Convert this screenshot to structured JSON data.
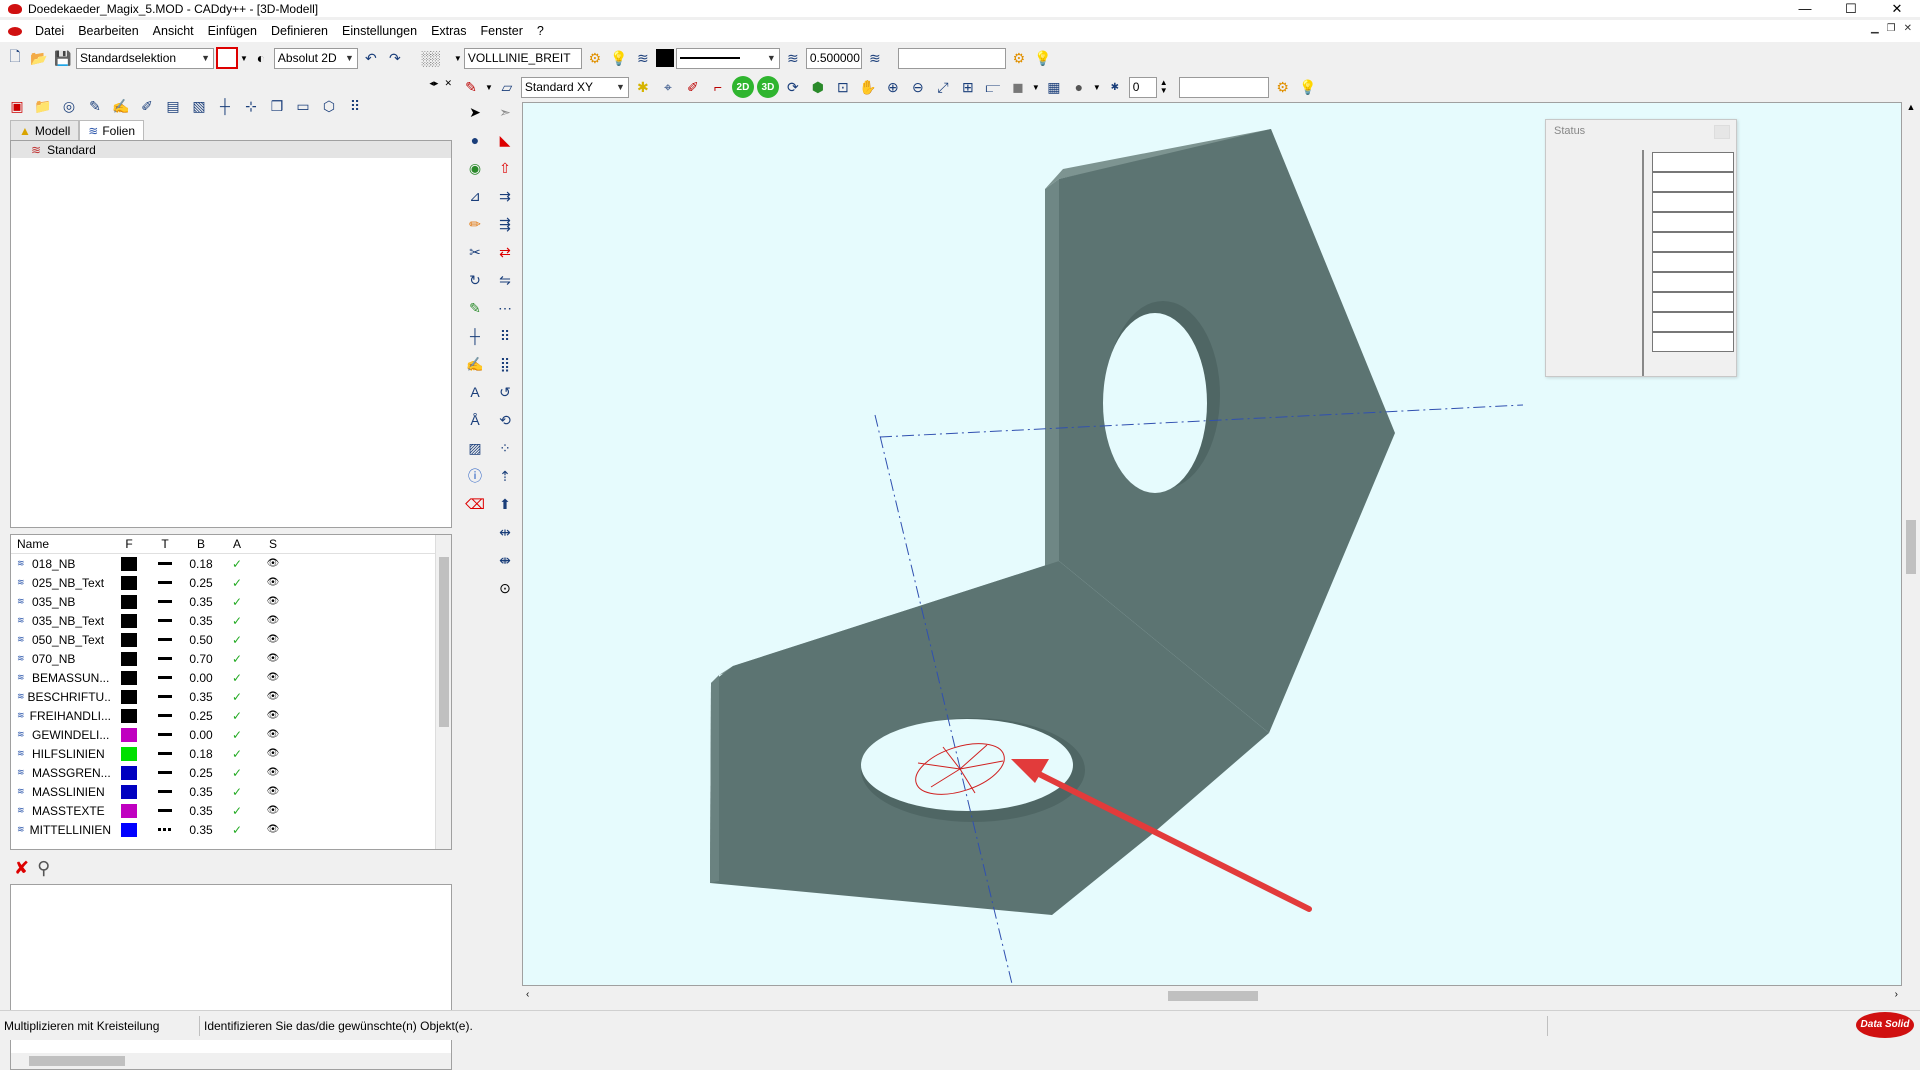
{
  "window": {
    "title": "Doedekaeder_Magix_5.MOD  -  CADdy++ - [3D-Modell]",
    "min": "—",
    "max": "☐",
    "close": "✕"
  },
  "menu": [
    "Datei",
    "Bearbeiten",
    "Ansicht",
    "Einfügen",
    "Definieren",
    "Einstellungen",
    "Extras",
    "Fenster",
    "?"
  ],
  "toolbar1": {
    "selection_mode": "Standardselektion",
    "coord_mode": "Absolut 2D",
    "linetype": "VOLLLINIE_BREIT",
    "linewidth": "0.500000",
    "empty_field": ""
  },
  "toolbar2": {
    "view_combo": "Standard XY",
    "btn_2d": "2D",
    "btn_3d": "3D",
    "counter": "0",
    "empty_field": ""
  },
  "left_panel": {
    "tabs": [
      "Modell",
      "Folien"
    ],
    "folien_tree": [
      "Standard"
    ],
    "columns": [
      "Name",
      "F",
      "T",
      "B",
      "A",
      "S"
    ],
    "layers": [
      {
        "name": "018_NB",
        "color": "#000000",
        "width": "0.18",
        "line": "solid"
      },
      {
        "name": "025_NB_Text",
        "color": "#000000",
        "width": "0.25",
        "line": "solid"
      },
      {
        "name": "035_NB",
        "color": "#000000",
        "width": "0.35",
        "line": "solid"
      },
      {
        "name": "035_NB_Text",
        "color": "#000000",
        "width": "0.35",
        "line": "solid"
      },
      {
        "name": "050_NB_Text",
        "color": "#000000",
        "width": "0.50",
        "line": "solid"
      },
      {
        "name": "070_NB",
        "color": "#000000",
        "width": "0.70",
        "line": "solid"
      },
      {
        "name": "BEMASSUN...",
        "color": "#000000",
        "width": "0.00",
        "line": "solid"
      },
      {
        "name": "BESCHRIFTU...",
        "color": "#000000",
        "width": "0.35",
        "line": "solid"
      },
      {
        "name": "FREIHANDLI...",
        "color": "#000000",
        "width": "0.25",
        "line": "solid"
      },
      {
        "name": "GEWINDELI...",
        "color": "#c000c0",
        "width": "0.00",
        "line": "solid"
      },
      {
        "name": "HILFSLINIEN",
        "color": "#00e000",
        "width": "0.18",
        "line": "solid"
      },
      {
        "name": "MASSGREN...",
        "color": "#0000c0",
        "width": "0.25",
        "line": "solid"
      },
      {
        "name": "MASSLINIEN",
        "color": "#0000c0",
        "width": "0.35",
        "line": "solid"
      },
      {
        "name": "MASSTEXTE",
        "color": "#c000c0",
        "width": "0.35",
        "line": "solid"
      },
      {
        "name": "MITTELLINIEN",
        "color": "#0000ff",
        "width": "0.35",
        "line": "dash"
      }
    ],
    "check": "✓",
    "eye": "👁"
  },
  "status_panel": {
    "title": "Status",
    "cells": 10
  },
  "statusbar": {
    "left": "Multiplizieren mit Kreisteilung",
    "right": "Identifizieren Sie das/die gewünschte(n) Objekt(e)."
  },
  "logo": "Data Solid",
  "colors": {
    "part_face": "#5c7472",
    "part_top": "#6f8785",
    "viewport_bg": "#e6fbfd",
    "arrow": "#e23b3b"
  }
}
